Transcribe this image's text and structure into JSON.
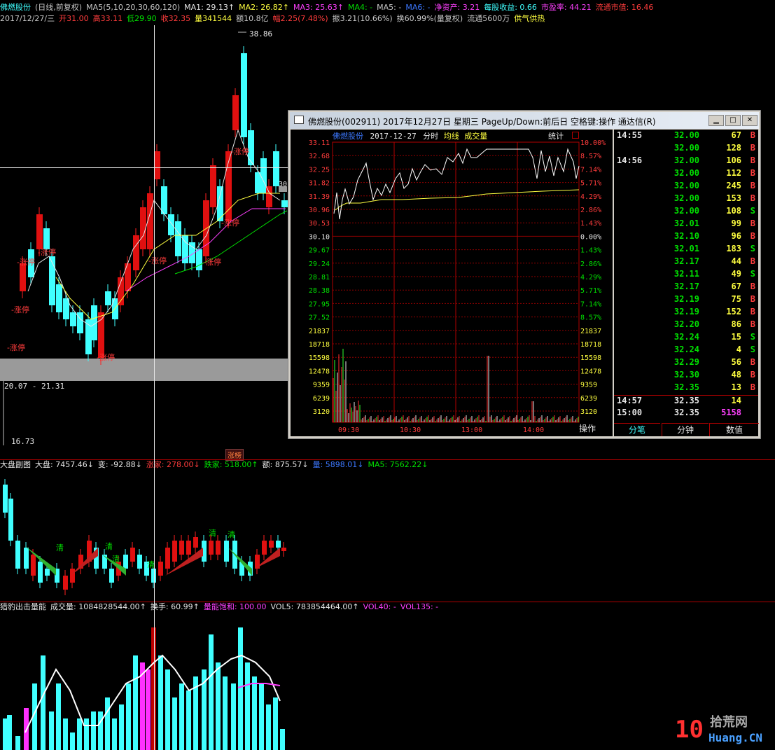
{
  "header": {
    "line1": [
      {
        "text": "佛燃股份",
        "color": "#40ffff"
      },
      {
        "text": "(日线,前复权)",
        "color": "#c8c8c8"
      },
      {
        "text": "MA5(5,10,20,30,60,120)",
        "color": "#c8c8c8"
      },
      {
        "text": "MA1: 29.13↑",
        "color": "#e6e6e6"
      },
      {
        "text": "MA2: 26.82↑",
        "color": "#ffff40"
      },
      {
        "text": "MA3: 25.63↑",
        "color": "#ff40ff"
      },
      {
        "text": "MA4: -",
        "color": "#00e000"
      },
      {
        "text": "MA5: -",
        "color": "#c8c8c8"
      },
      {
        "text": "MA6: -",
        "color": "#3c78ff"
      },
      {
        "text": "净资产: 3.21",
        "color": "#ff40ff"
      },
      {
        "text": "每股收益: 0.66",
        "color": "#40ffff"
      },
      {
        "text": "市盈率: 44.21",
        "color": "#ff40ff"
      },
      {
        "text": "流通市值: 16.46",
        "color": "#ff3c3c"
      }
    ],
    "line2": [
      {
        "text": "2017/12/27/三",
        "color": "#c8c8c8"
      },
      {
        "text": "开31.00",
        "color": "#ff3c3c"
      },
      {
        "text": "高33.11",
        "color": "#ff3c3c"
      },
      {
        "text": "低29.90",
        "color": "#00e000"
      },
      {
        "text": "收32.35",
        "color": "#ff3c3c"
      },
      {
        "text": "量341544",
        "color": "#ffff40"
      },
      {
        "text": "额10.8亿",
        "color": "#c8c8c8"
      },
      {
        "text": "幅2.25(7.48%)",
        "color": "#ff3c3c"
      },
      {
        "text": "振3.21(10.66%)",
        "color": "#c8c8c8"
      },
      {
        "text": "换60.99%(量复权)",
        "color": "#c8c8c8"
      },
      {
        "text": "流通5600万",
        "color": "#c8c8c8"
      },
      {
        "text": "供气供热",
        "color": "#ffff40"
      }
    ]
  },
  "main_chart": {
    "high_label": "38.86",
    "low_label": "16.73",
    "range_label": "20.07 - 21.31",
    "price_side_label": "30",
    "limit_up_label": "涨停",
    "tag": "涨榜"
  },
  "sub1": {
    "header": [
      {
        "text": "大盘副图",
        "color": "#e6e6e6"
      },
      {
        "text": "大盘: 7457.46↓",
        "color": "#e6e6e6"
      },
      {
        "text": "变: -92.88↓",
        "color": "#e6e6e6"
      },
      {
        "text": "涨家: 278.00↓",
        "color": "#ff3c3c"
      },
      {
        "text": "跌家: 518.00↑",
        "color": "#00e000"
      },
      {
        "text": "额: 875.57↓",
        "color": "#e6e6e6"
      },
      {
        "text": "量: 5898.01↓",
        "color": "#3c78ff"
      },
      {
        "text": "MA5: 7562.22↓",
        "color": "#00e000"
      }
    ],
    "mark_label": "清"
  },
  "sub2": {
    "header": [
      {
        "text": "猎豹出击量能",
        "color": "#e6e6e6"
      },
      {
        "text": "成交量: 1084828544.00↑",
        "color": "#e6e6e6"
      },
      {
        "text": "换手: 60.99↑",
        "color": "#e6e6e6"
      },
      {
        "text": "量能饱和: 100.00",
        "color": "#ff40ff"
      },
      {
        "text": "VOL5: 783854464.00↑",
        "color": "#e6e6e6"
      },
      {
        "text": "VOL40: -",
        "color": "#ff40ff"
      },
      {
        "text": "VOL135: -",
        "color": "#ff40ff"
      }
    ]
  },
  "popup": {
    "title": "佛燃股份(002911) 2017年12月27日 星期三 PageUp/Down:前后日 空格键:操作 通达信(R)",
    "stock_name": "佛燃股份",
    "date": "2017-12-27",
    "tab_minute": "分时",
    "tab_avg": "均线",
    "tab_vol": "成交量",
    "stat_label": "统计",
    "op_label": "操作",
    "tabs": [
      "分笔",
      "分钟",
      "数值"
    ],
    "colors": {
      "up": "#ff3c3c",
      "down": "#00e000",
      "flat": "#e6e6e6"
    },
    "price_ticks": [
      "33.11",
      "32.68",
      "32.25",
      "31.82",
      "31.39",
      "30.96",
      "30.53",
      "30.10",
      "29.67",
      "29.24",
      "28.81",
      "28.38",
      "27.95",
      "27.52"
    ],
    "pct_ticks": [
      "10.00%",
      "8.57%",
      "7.14%",
      "5.71%",
      "4.29%",
      "2.86%",
      "1.43%",
      "0.00%",
      "1.43%",
      "2.86%",
      "4.29%",
      "5.71%",
      "7.14%",
      "8.57%"
    ],
    "vol_ticks": [
      "21837",
      "18718",
      "15598",
      "12478",
      "9359",
      "6239",
      "3120"
    ],
    "time_ticks": [
      "09:30",
      "10:30",
      "13:00",
      "14:00"
    ]
  },
  "ticks": [
    {
      "time": "14:55",
      "price": "32.00",
      "vol": "67",
      "side": "B",
      "dir": "down"
    },
    {
      "time": "",
      "price": "32.00",
      "vol": "128",
      "side": "B",
      "dir": "down"
    },
    {
      "time": "14:56",
      "price": "32.00",
      "vol": "106",
      "side": "B",
      "dir": "down"
    },
    {
      "time": "",
      "price": "32.00",
      "vol": "112",
      "side": "B",
      "dir": "down"
    },
    {
      "time": "",
      "price": "32.00",
      "vol": "245",
      "side": "B",
      "dir": "down"
    },
    {
      "time": "",
      "price": "32.00",
      "vol": "153",
      "side": "B",
      "dir": "down"
    },
    {
      "time": "",
      "price": "32.00",
      "vol": "108",
      "side": "S",
      "dir": "down"
    },
    {
      "time": "",
      "price": "32.01",
      "vol": "99",
      "side": "B",
      "dir": "down"
    },
    {
      "time": "",
      "price": "32.10",
      "vol": "96",
      "side": "B",
      "dir": "down"
    },
    {
      "time": "",
      "price": "32.01",
      "vol": "183",
      "side": "S",
      "dir": "down"
    },
    {
      "time": "",
      "price": "32.17",
      "vol": "44",
      "side": "B",
      "dir": "down"
    },
    {
      "time": "",
      "price": "32.11",
      "vol": "49",
      "side": "S",
      "dir": "down"
    },
    {
      "time": "",
      "price": "32.17",
      "vol": "67",
      "side": "B",
      "dir": "down"
    },
    {
      "time": "",
      "price": "32.19",
      "vol": "75",
      "side": "B",
      "dir": "down"
    },
    {
      "time": "",
      "price": "32.19",
      "vol": "152",
      "side": "B",
      "dir": "down"
    },
    {
      "time": "",
      "price": "32.20",
      "vol": "86",
      "side": "B",
      "dir": "down"
    },
    {
      "time": "",
      "price": "32.24",
      "vol": "15",
      "side": "S",
      "dir": "down"
    },
    {
      "time": "",
      "price": "32.24",
      "vol": "4",
      "side": "S",
      "dir": "down"
    },
    {
      "time": "",
      "price": "32.29",
      "vol": "56",
      "side": "B",
      "dir": "down"
    },
    {
      "time": "",
      "price": "32.30",
      "vol": "48",
      "side": "B",
      "dir": "down"
    },
    {
      "time": "",
      "price": "32.35",
      "vol": "13",
      "side": "B",
      "dir": "down"
    },
    {
      "time": "14:57",
      "price": "32.35",
      "vol": "14",
      "side": "",
      "dir": "flat"
    },
    {
      "time": "15:00",
      "price": "32.35",
      "vol": "5158",
      "side": "",
      "dir": "flat"
    }
  ],
  "logo": {
    "digits": "10",
    "cn": "拾荒网",
    "en": "Huang.CN"
  }
}
